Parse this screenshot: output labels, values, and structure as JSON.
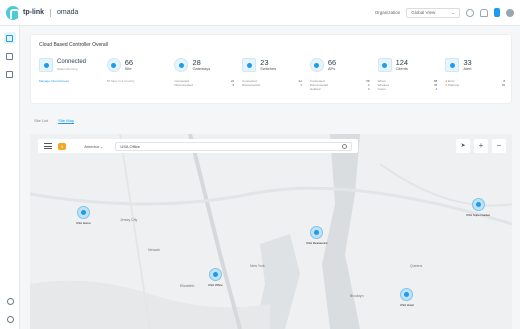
{
  "header": {
    "logo_text": "tp-link",
    "product": "omada",
    "org_label": "Organization",
    "org_value": "Global View"
  },
  "sidebar": {
    "items": [
      {
        "name": "dashboard",
        "icon": "dashboard-icon",
        "active": true
      },
      {
        "name": "devices",
        "icon": "devices-icon",
        "active": false
      },
      {
        "name": "sites",
        "icon": "building-icon",
        "active": false
      }
    ],
    "bottom": [
      {
        "name": "account",
        "icon": "user-icon"
      },
      {
        "name": "settings",
        "icon": "gear-icon"
      }
    ]
  },
  "overview": {
    "title": "Cloud Based Controller Overall",
    "status": "Connected",
    "status_sub": "Status Running",
    "status_link": "Manage Cloud Access",
    "tiles": [
      {
        "num": "66",
        "label": "Site",
        "sub": "66 Sites in 2 Country"
      },
      {
        "num": "28",
        "label": "Gateways",
        "row1l": "Connected",
        "row1r": "22",
        "row2l": "Disconnected",
        "row2r": "6"
      },
      {
        "num": "23",
        "label": "Switches",
        "row1l": "Connected",
        "row1r": "22",
        "row2l": "Disconnected",
        "row2r": "1"
      },
      {
        "num": "66",
        "label": "APs",
        "row1l": "Connected",
        "row1r": "58",
        "row2l": "Disconnected",
        "row2r": "4",
        "row3l": "Isolated",
        "row3r": "4"
      },
      {
        "num": "124",
        "label": "Clients",
        "row1l": "Wired",
        "row1r": "88",
        "row2l": "Wireless",
        "row2r": "36",
        "row3l": "Guest",
        "row3r": "4"
      },
      {
        "num": "33",
        "label": "Alert",
        "row1l": "Error",
        "row1r": "8",
        "row2l": "Warning",
        "row2r": "25"
      }
    ]
  },
  "views": {
    "list": "Site List",
    "map": "Site Map"
  },
  "map": {
    "badge": "5",
    "select": "America",
    "search_value": "USA Office",
    "sites": [
      {
        "label": "USA Home"
      },
      {
        "label": "USA Office"
      },
      {
        "label": "USA Restaurant"
      },
      {
        "label": "USA Supermarket"
      },
      {
        "label": "USA Hotel"
      }
    ],
    "places": [
      "Newark",
      "New York",
      "Elizabeth",
      "Jersey City",
      "Brooklyn",
      "Queens"
    ]
  }
}
